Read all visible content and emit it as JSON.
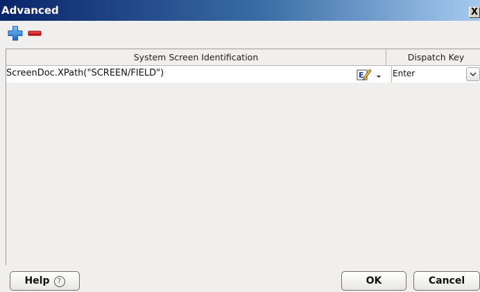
{
  "window": {
    "title": "Advanced",
    "close_label": "X"
  },
  "toolbar": {
    "add_icon": "plus-icon",
    "remove_icon": "minus-icon",
    "add_color": "#2a7fd4",
    "remove_color": "#cc0000"
  },
  "table": {
    "columns": [
      "System Screen Identification",
      "Dispatch Key"
    ],
    "rows": [
      {
        "identification": "ScreenDoc.XPath(\"SCREEN/FIELD\")",
        "dispatch_key": "Enter"
      }
    ]
  },
  "buttons": {
    "help": "Help",
    "help_icon": "?",
    "ok": "OK",
    "cancel": "Cancel"
  }
}
